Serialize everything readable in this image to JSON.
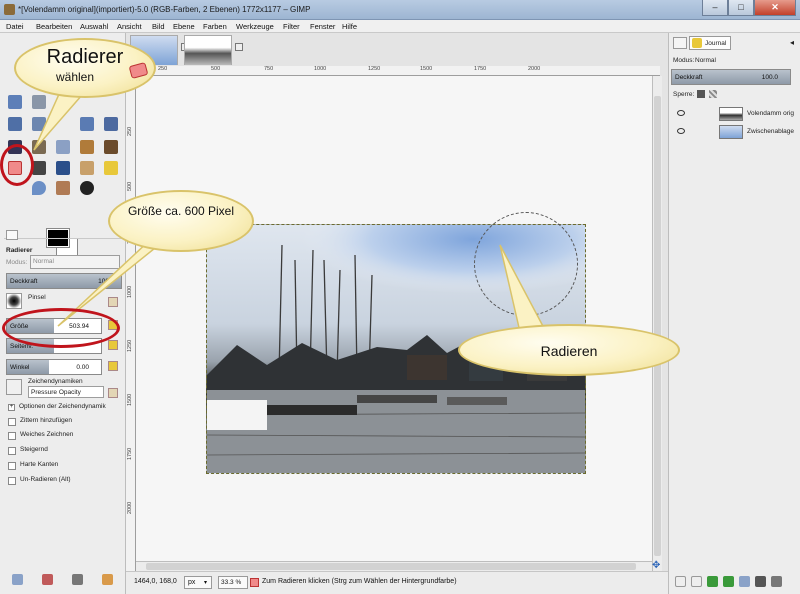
{
  "window": {
    "title": "*[Volendamm original](importiert)-5.0 (RGB-Farben, 2 Ebenen) 1772x1177 – GIMP",
    "minimize": "–",
    "maximize": "□",
    "close": "✕"
  },
  "menu": [
    "Datei",
    "Bearbeiten",
    "Auswahl",
    "Ansicht",
    "Bild",
    "Ebene",
    "Farben",
    "Werkzeuge",
    "Filter",
    "Fenster",
    "Hilfe"
  ],
  "ruler_ticks": [
    "250",
    "500",
    "750",
    "1000",
    "1250",
    "1500",
    "1750",
    "2000"
  ],
  "tool_options": {
    "tool_name": "Radierer",
    "mode_label": "Modus:",
    "mode_value": "Normal",
    "opacity_label": "Deckkraft",
    "opacity_value": "100",
    "brush_label": "Pinsel",
    "size_label": "Größe",
    "size_value": "503.94",
    "size_fraction": 0.5,
    "aspect_label": "Seitenv.",
    "angle_label": "Winkel",
    "angle_value": "0.00",
    "dynamics_label": "Zeichendynamiken",
    "dynamics_value": "Pressure Opacity",
    "dynamics_options": "Optionen der Zeichendynamik",
    "checkboxes": [
      "Zittern hinzufügen",
      "Weiches Zeichnen",
      "Steigernd",
      "Harte Kanten",
      "Un-Radieren (Alt)"
    ]
  },
  "status": {
    "coords": "1464,0, 168,0",
    "unit": "px",
    "zoom": "33.3 %",
    "message": "Zum Radieren klicken (Strg zum Wählen der Hintergrundfarbe)"
  },
  "layers_panel": {
    "tab_label": "Journal",
    "mode_label": "Modus:",
    "mode_value": "Normal",
    "opacity_label": "Deckkraft",
    "opacity_value": "100.0",
    "lock_label": "Sperre:",
    "layers": [
      {
        "name": "Volendamm orig"
      },
      {
        "name": "Zwischenablage"
      }
    ]
  },
  "callouts": {
    "choose_title": "Radierer",
    "choose_sub": "wählen",
    "size_note": "Größe ca. 600 Pixel",
    "erase_note": "Radieren"
  },
  "colors": {
    "highlight_ring": "#c0141c",
    "bubble_border": "#d9c36a"
  }
}
